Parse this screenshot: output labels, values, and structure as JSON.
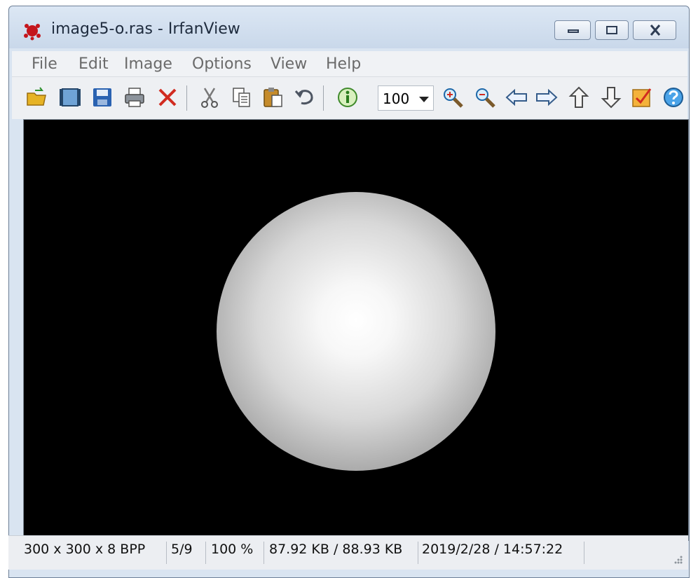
{
  "window": {
    "title": "image5-o.ras - IrfanView",
    "app_icon": "irfanview-icon",
    "controls": {
      "minimize_icon": "minimize-icon",
      "maximize_icon": "maximize-icon",
      "close_icon": "close-icon"
    }
  },
  "menu": {
    "items": [
      {
        "label": "File"
      },
      {
        "label": "Edit"
      },
      {
        "label": "Image"
      },
      {
        "label": "Options"
      },
      {
        "label": "View"
      },
      {
        "label": "Help"
      }
    ]
  },
  "toolbar": {
    "buttons": [
      "open-folder-icon",
      "slideshow-icon",
      "save-icon",
      "print-icon",
      "delete-icon",
      "cut-icon",
      "copy-icon",
      "paste-icon",
      "undo-icon",
      "info-icon",
      "zoom-in-icon",
      "zoom-out-icon",
      "previous-icon",
      "next-icon",
      "first-icon",
      "last-icon",
      "properties-icon",
      "help-icon"
    ],
    "zoom": {
      "value": "100"
    }
  },
  "viewer": {
    "background": "#000000",
    "content": "sphere-image"
  },
  "status": {
    "dimensions": "300 x 300 x 8 BPP",
    "index": "5/9",
    "zoom": "100 %",
    "filesize": "87.92 KB / 88.93 KB",
    "datetime": "2019/2/28 / 14:57:22"
  }
}
